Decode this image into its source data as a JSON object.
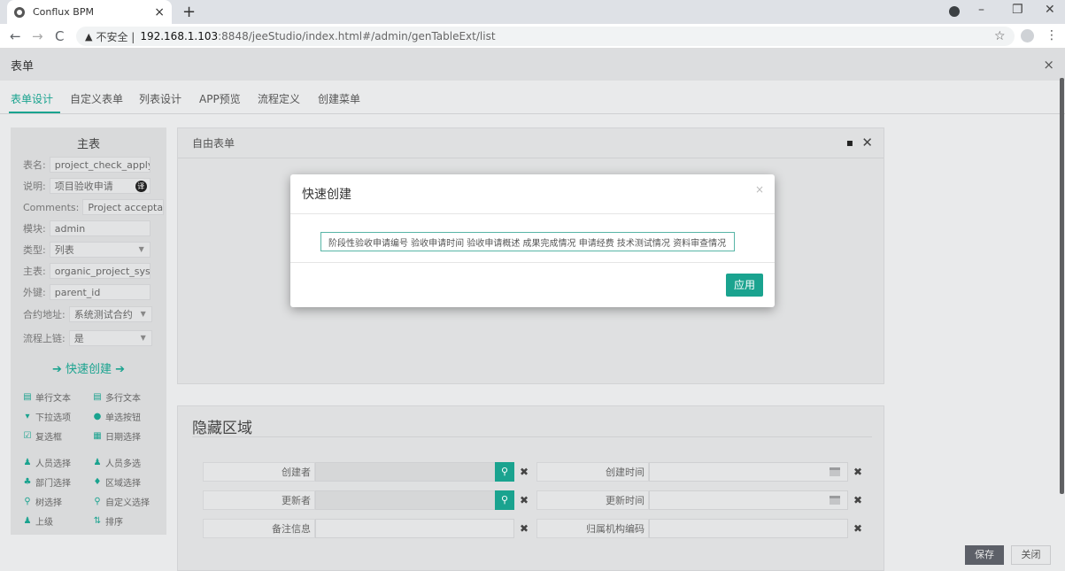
{
  "browser": {
    "tab_title": "Conflux BPM",
    "tab_close": "×",
    "new_tab": "+",
    "back": "←",
    "forward": "→",
    "reload": "C",
    "warning_glyph": "▲",
    "insecure_label": "不安全 |",
    "url_host": "192.168.1.103",
    "url_path": ":8848/jeeStudio/index.html#/admin/genTableExt/list",
    "bookmark": "☆",
    "menu": "⋮",
    "minimize": "–",
    "maximize": "❐",
    "close": "✕"
  },
  "page": {
    "title": "表单",
    "close": "×"
  },
  "tabs": [
    {
      "label": "表单设计",
      "active": true
    },
    {
      "label": "自定义表单",
      "active": false
    },
    {
      "label": "列表设计",
      "active": false
    },
    {
      "label": "APP预览",
      "active": false
    },
    {
      "label": "流程定义",
      "active": false
    },
    {
      "label": "创建菜单",
      "active": false
    }
  ],
  "left_panel": {
    "title": "主表",
    "fields": [
      {
        "label": "表名:",
        "value": "project_check_apply"
      },
      {
        "label": "说明:",
        "value": "项目验收申请"
      },
      {
        "label": "Comments:",
        "value": "Project acceptance"
      },
      {
        "label": "模块:",
        "value": "admin"
      },
      {
        "label": "类型:",
        "value": "列表"
      },
      {
        "label": "主表:",
        "value": "organic_project_system"
      },
      {
        "label": "外键:",
        "value": "parent_id"
      },
      {
        "label": "合约地址:",
        "value": "系统测试合约"
      },
      {
        "label": "流程上链:",
        "value": "是"
      }
    ],
    "desc_badge": "译",
    "quick_create": "➔  快速创建  ➔",
    "widgets": [
      {
        "icon": "▤",
        "label": "单行文本"
      },
      {
        "icon": "▤",
        "label": "多行文本"
      },
      {
        "icon": "▾",
        "label": "下拉选项"
      },
      {
        "icon": "●",
        "label": "单选按钮"
      },
      {
        "icon": "☑",
        "label": "复选框"
      },
      {
        "icon": "▦",
        "label": "日期选择"
      },
      {
        "icon": "♟",
        "label": "人员选择"
      },
      {
        "icon": "♟",
        "label": "人员多选"
      },
      {
        "icon": "♣",
        "label": "部门选择"
      },
      {
        "icon": "♦",
        "label": "区域选择"
      },
      {
        "icon": "⚲",
        "label": "树选择"
      },
      {
        "icon": "⚲",
        "label": "自定义选择"
      },
      {
        "icon": "♟",
        "label": "上级"
      },
      {
        "icon": "⇅",
        "label": "排序"
      }
    ]
  },
  "free_form": {
    "title": "自由表单",
    "restore": "▪",
    "close": "✕"
  },
  "hidden_area": {
    "title": "隐藏区域",
    "rows": [
      {
        "left": "创建者",
        "right": "创建时间"
      },
      {
        "left": "更新者",
        "right": "更新时间"
      },
      {
        "left": "备注信息",
        "right": "归属机构编码"
      }
    ],
    "search_glyph": "⚲",
    "clear_glyph": "✖"
  },
  "footer": {
    "save": "保存",
    "close": "关闭"
  },
  "modal": {
    "title": "快速创建",
    "close": "×",
    "input_value": "阶段性验收申请编号 验收申请时间 验收申请概述 成果完成情况 申请经费 技术测试情况 资料审查情况",
    "apply": "应用"
  }
}
